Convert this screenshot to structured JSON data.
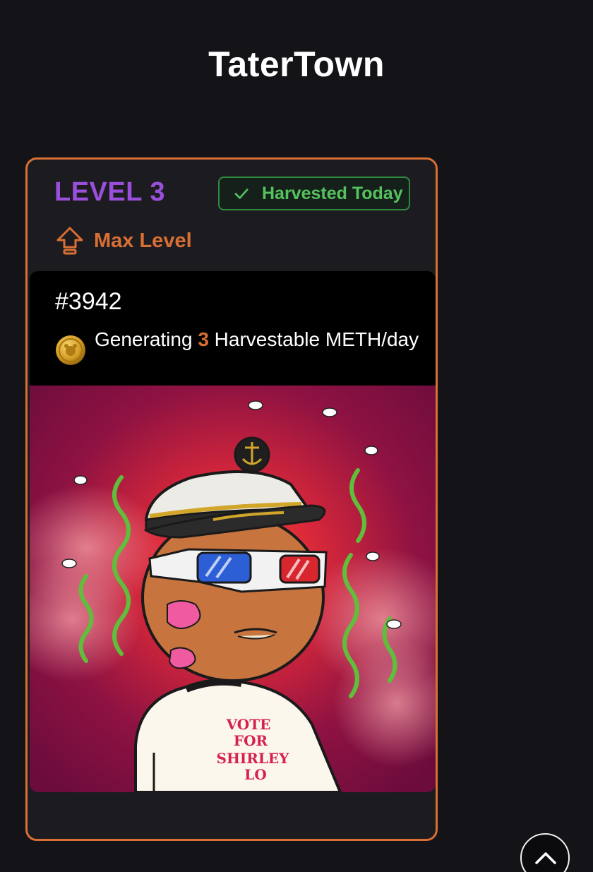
{
  "app": {
    "title": "TaterTown"
  },
  "card": {
    "level_label": "LEVEL 3",
    "harvest_status": "Harvested Today",
    "max_level_label": "Max Level",
    "token_id": "#3942",
    "generating_prefix": "Generating ",
    "generating_amount": "3",
    "generating_suffix": " Harvestable METH/day",
    "artwork": {
      "shirt_text": [
        "VOTE",
        "FOR",
        "SHIRLEY",
        "LO"
      ],
      "description_icon": "potato-character-art"
    }
  },
  "icons": {
    "check": "check-icon",
    "max_level": "arrow-up-icon",
    "coin": "meth-coin-icon",
    "scroll_top": "chevron-up-icon"
  },
  "colors": {
    "background": "#141418",
    "card_border": "#d96f34",
    "level": "#9a4fdc",
    "harvested": "#56c25e",
    "accent": "#d96f34"
  }
}
